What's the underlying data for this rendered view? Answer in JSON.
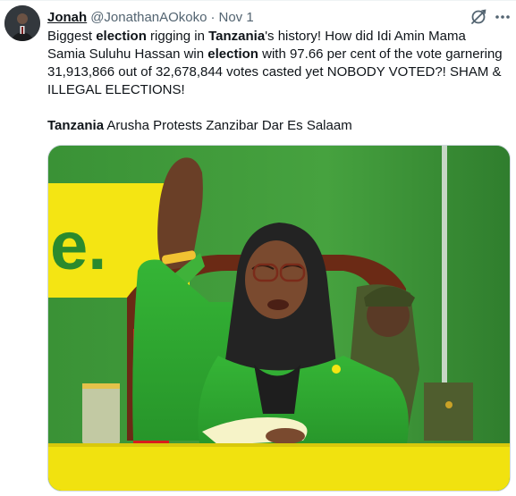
{
  "tweet": {
    "author_name": "Jonah",
    "author_handle": "@JonathanAOkoko",
    "separator": "·",
    "date": "Nov 1",
    "text_segments": [
      {
        "t": "Biggest ",
        "bold": false
      },
      {
        "t": "election",
        "bold": true
      },
      {
        "t": " rigging in ",
        "bold": false
      },
      {
        "t": "Tanzania",
        "bold": true
      },
      {
        "t": "'s history! How did Idi Amin Mama Samia Suluhu Hassan win ",
        "bold": false
      },
      {
        "t": "election",
        "bold": true
      },
      {
        "t": " with 97.66 per cent of the vote garnering 31,913,866 out of 32,678,844 votes casted yet NOBODY VOTED?! SHAM & ILLEGAL ELECTIONS!",
        "bold": false
      }
    ],
    "tags_bold": "Tanzania",
    "tags_rest": " Arusha Protests Zanzibar Dar Es Salaam",
    "media": {
      "banner_text": "e."
    }
  },
  "icons": {
    "grok": "grok-icon",
    "more": "more-options-icon"
  },
  "colors": {
    "text": "#0f1419",
    "secondary": "#536471",
    "border": "#cfd9de",
    "banner_yellow": "#f4e513",
    "backdrop_green": "#3f9a3c"
  }
}
